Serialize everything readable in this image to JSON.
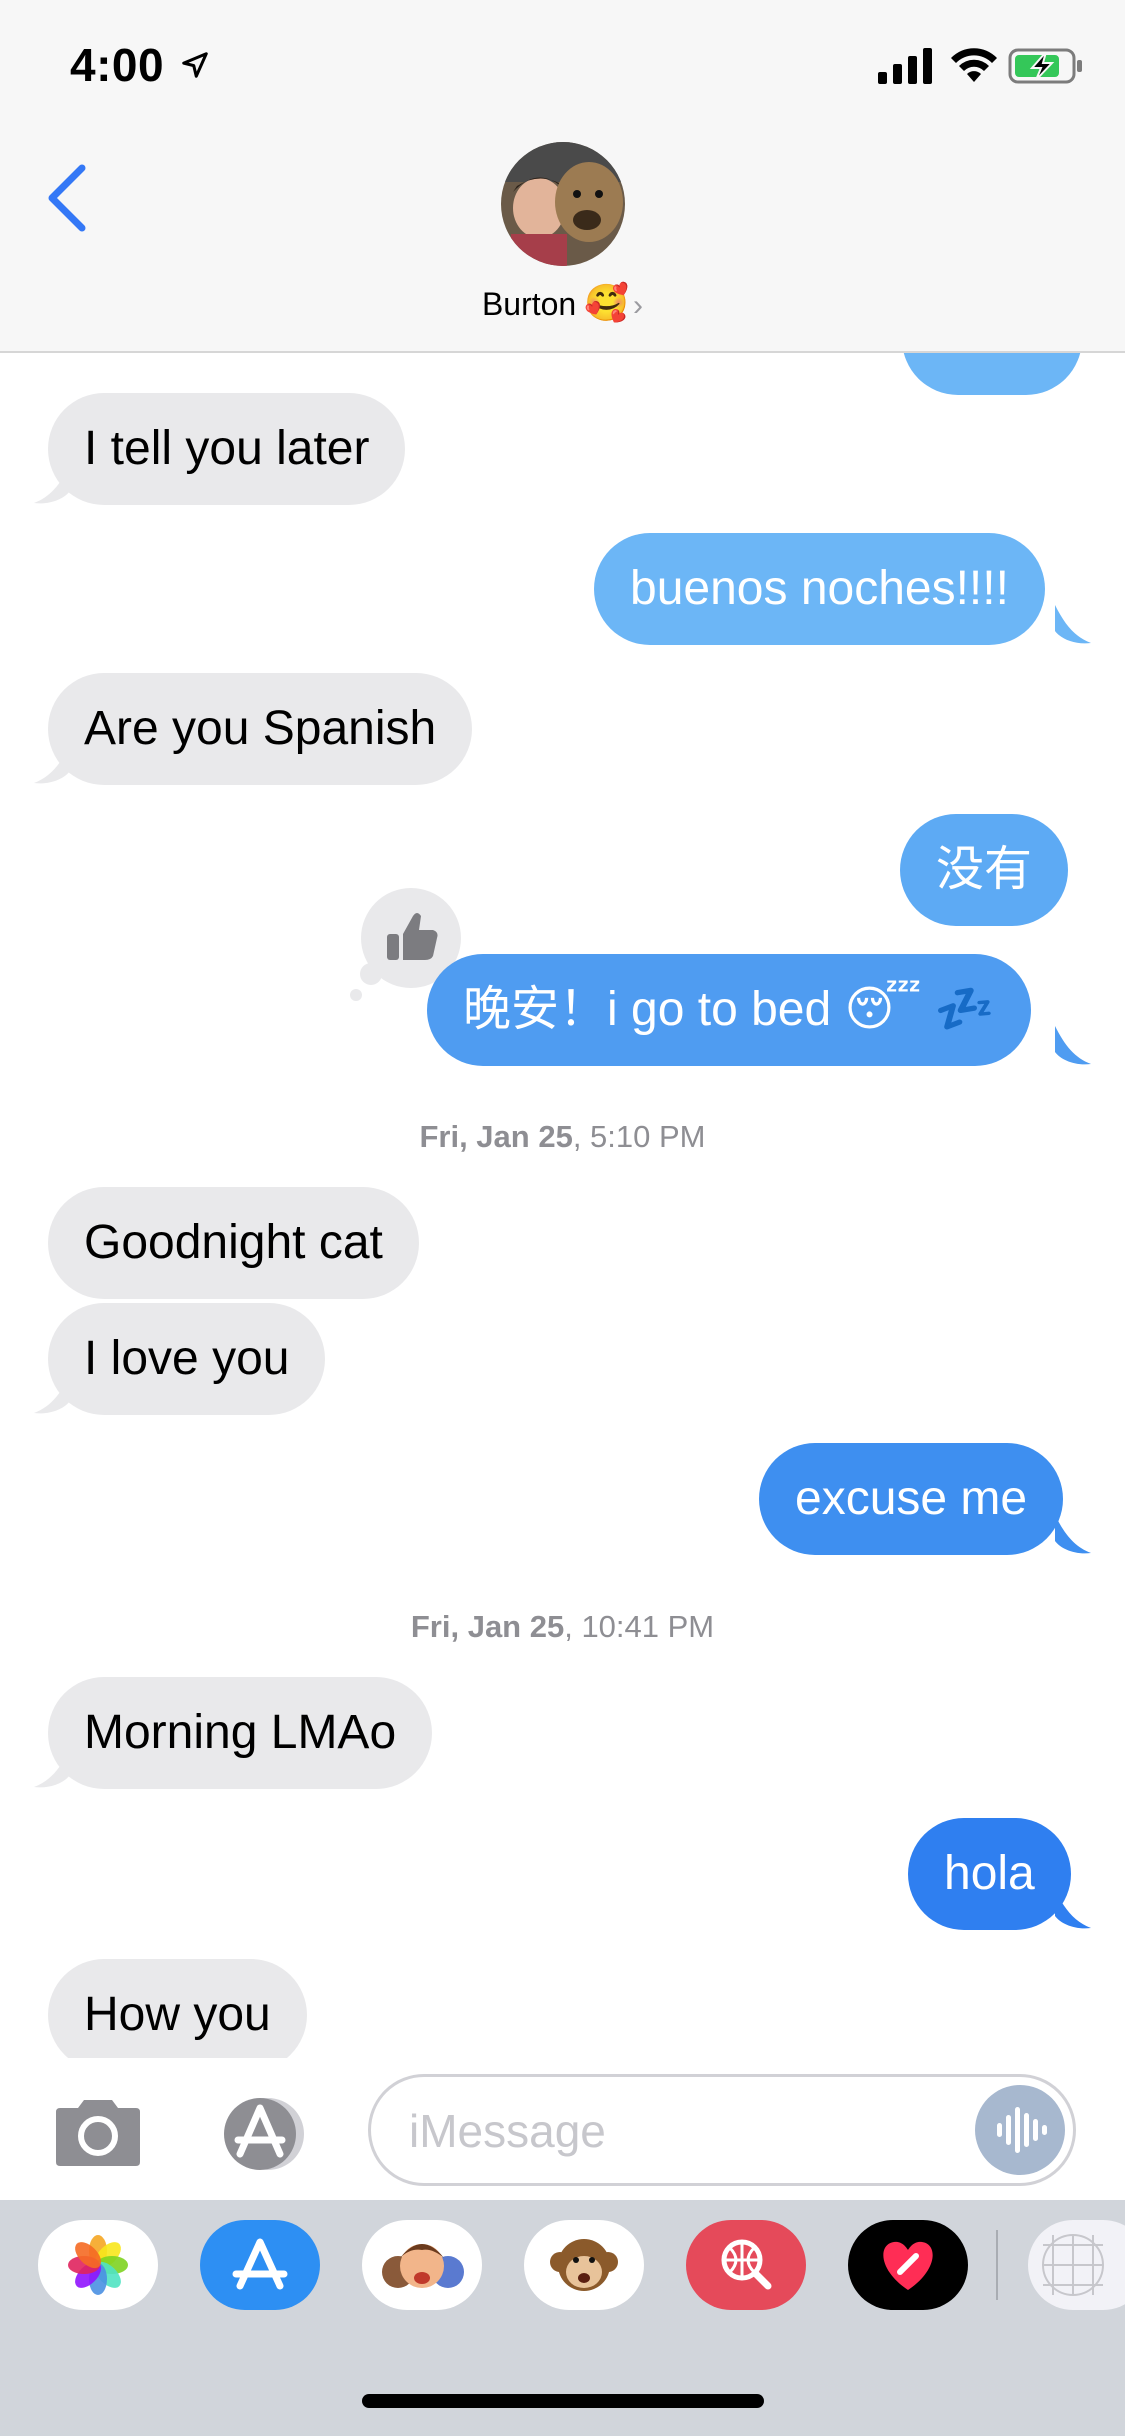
{
  "status": {
    "time": "4:00",
    "icons": [
      "location-arrow-icon",
      "cellular-signal-icon",
      "wifi-icon",
      "battery-charging-icon"
    ]
  },
  "header": {
    "back_icon": "chevron-left-icon",
    "contact_name": "Burton",
    "contact_emoji": "🥰",
    "contact_chevron": "›"
  },
  "messages": [
    {
      "dir": "in",
      "text": "I tell you later"
    },
    {
      "dir": "out",
      "text": "buenos noches!!!!"
    },
    {
      "dir": "in",
      "text": "Are you Spanish"
    },
    {
      "dir": "out",
      "text": "没有"
    },
    {
      "dir": "out",
      "text": "晚安！i go to bed 😴 💤",
      "tapback": "thumbs-up-icon"
    },
    {
      "dir": "in",
      "text": "Goodnight cat"
    },
    {
      "dir": "in",
      "text": "I love you"
    },
    {
      "dir": "out",
      "text": "excuse me"
    },
    {
      "dir": "in",
      "text": "Morning LMAo"
    },
    {
      "dir": "out",
      "text": "hola"
    },
    {
      "dir": "in",
      "text": "How you"
    }
  ],
  "timestamps": [
    {
      "day": "Fri, Jan 25",
      "time": ", 5:10 PM"
    },
    {
      "day": "Fri, Jan 25",
      "time": ", 10:41 PM"
    }
  ],
  "compose": {
    "placeholder": "iMessage",
    "icons": [
      "camera-icon",
      "app-store-icon",
      "audio-waveform-icon"
    ]
  },
  "app_drawer": [
    "photos-app-icon",
    "app-store-app-icon",
    "memoji-app-icon",
    "animoji-app-icon",
    "web-images-search-icon",
    "digital-touch-icon",
    "more-apps-icon"
  ],
  "colors": {
    "incoming": "#e9e9eb",
    "outgoing_light": "#6cb6f6",
    "outgoing_mid": "#4f9cf1",
    "outgoing_dark": "#2f7ff0",
    "ios_blue": "#3478f6"
  }
}
